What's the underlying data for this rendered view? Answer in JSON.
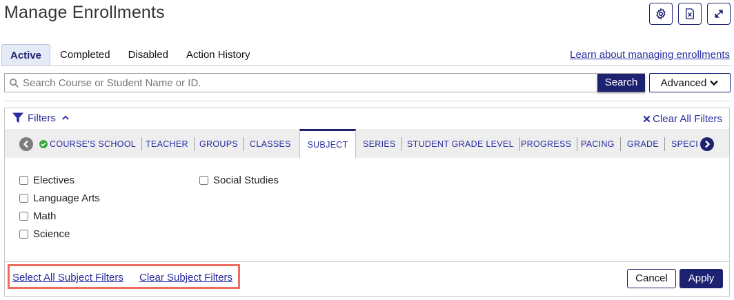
{
  "page": {
    "title": "Manage Enrollments"
  },
  "toolbar": {
    "icons": [
      "gear-icon",
      "excel-export-icon",
      "expand-icon"
    ],
    "accent_color": "#1d2270"
  },
  "tabs": [
    {
      "label": "Active",
      "active": true
    },
    {
      "label": "Completed",
      "active": false
    },
    {
      "label": "Disabled",
      "active": false
    },
    {
      "label": "Action History",
      "active": false
    }
  ],
  "learn_link": "Learn about managing enrollments",
  "search": {
    "placeholder": "Search Course or Student Name or ID.",
    "value": "",
    "button_label": "Search",
    "advanced_label": "Advanced"
  },
  "filters": {
    "label": "Filters",
    "clear_all_label": "Clear All Filters",
    "tabs": [
      {
        "label": "COURSE'S SCHOOL",
        "has_active_filter": true
      },
      {
        "label": "TEACHER"
      },
      {
        "label": "GROUPS"
      },
      {
        "label": "CLASSES"
      },
      {
        "label": "SUBJECT",
        "active": true
      },
      {
        "label": "SERIES"
      },
      {
        "label": "STUDENT GRADE LEVEL"
      },
      {
        "label": "PROGRESS"
      },
      {
        "label": "PACING"
      },
      {
        "label": "GRADE"
      },
      {
        "label": "SPECIA"
      }
    ],
    "subject_options": [
      {
        "label": "Electives",
        "checked": false
      },
      {
        "label": "Language Arts",
        "checked": false
      },
      {
        "label": "Math",
        "checked": false
      },
      {
        "label": "Science",
        "checked": false
      },
      {
        "label": "Social Studies",
        "checked": false
      }
    ],
    "select_all_label": "Select All Subject Filters",
    "clear_subject_label": "Clear Subject Filters",
    "cancel_label": "Cancel",
    "apply_label": "Apply",
    "highlight_color": "#ee6b5f",
    "active_badge_color": "#3aa83a"
  }
}
